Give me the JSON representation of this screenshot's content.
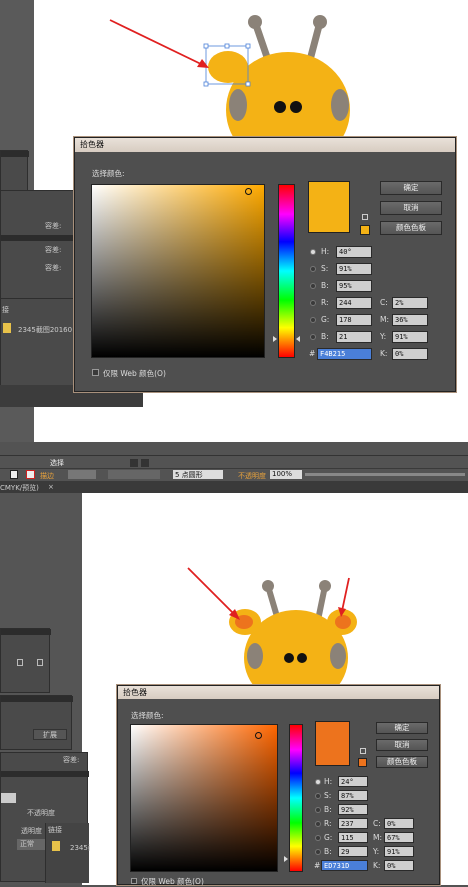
{
  "top": {
    "dialog_title": "拾色器",
    "select_color_label": "选择颜色:",
    "ok": "确定",
    "cancel": "取消",
    "swatches": "颜色色板",
    "web_only": "仅限 Web 颜色(O)",
    "fields": {
      "h_label": "H:",
      "h": "40°",
      "s_label": "S:",
      "s": "91%",
      "b_label": "B:",
      "b": "95%",
      "r_label": "R:",
      "r": "244",
      "g_label": "G:",
      "g": "178",
      "bb_label": "B:",
      "bb": "21",
      "c_label": "C:",
      "c": "2%",
      "m_label": "M:",
      "m": "36%",
      "y_label": "Y:",
      "y": "91%",
      "k_label": "K:",
      "k": "0%",
      "hex_label": "#",
      "hex": "F4B215"
    },
    "color": "#F4B215",
    "hue_base": "#ffaa00",
    "side_panel": {
      "tab_label": "接",
      "file": "2345截图20160",
      "tolerance_label": "容差:"
    }
  },
  "toolbar": {
    "select_label": "选择",
    "stroke_label": "描边",
    "brush": "5 点圆形",
    "opacity_label": "不透明度",
    "opacity_value": "100%",
    "doc_tab": "CMYK/预览)"
  },
  "bottom": {
    "dialog_title": "拾色器",
    "select_color_label": "选择颜色:",
    "ok": "确定",
    "cancel": "取消",
    "swatches": "颜色色板",
    "web_only": "仅限 Web 颜色(O)",
    "fields": {
      "h_label": "H:",
      "h": "24°",
      "s_label": "S:",
      "s": "87%",
      "b_label": "B:",
      "b": "92%",
      "r_label": "R:",
      "r": "237",
      "g_label": "G:",
      "g": "115",
      "bb_label": "B:",
      "bb": "29",
      "c_label": "C:",
      "c": "0%",
      "m_label": "M:",
      "m": "67%",
      "y_label": "Y:",
      "y": "91%",
      "k_label": "K:",
      "k": "0%",
      "hex_label": "#",
      "hex": "ED731D"
    },
    "color": "#ED731D",
    "hue_base": "#ff6600",
    "side_panel": {
      "tolerance_label": "容差:",
      "expand": "扩展",
      "opacity": "不透明度",
      "opacity2": "透明度",
      "normal": "正常",
      "link_tab": "链接",
      "file": "2345截图20160"
    }
  }
}
